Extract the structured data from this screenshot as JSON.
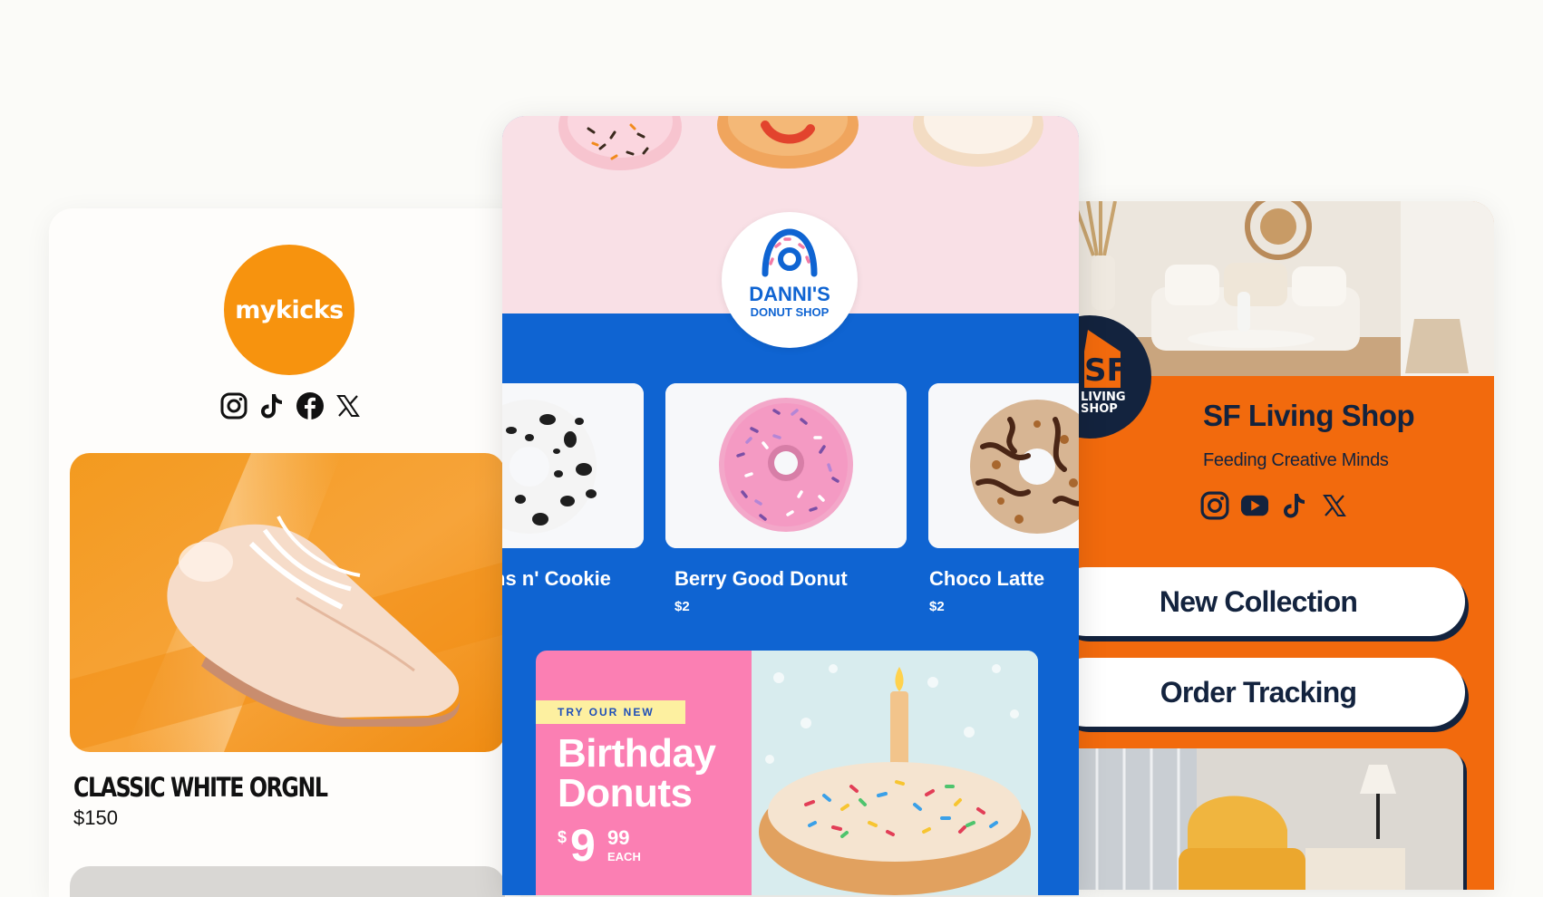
{
  "left_card": {
    "brand_logo_text": "mykicks",
    "social_icons": [
      "instagram-icon",
      "tiktok-icon",
      "facebook-icon",
      "x-icon"
    ],
    "product": {
      "name": "CLASSIC WHITE ORGNL",
      "price": "$150"
    },
    "colors": {
      "brand": "#f7930e"
    }
  },
  "middle_card": {
    "logo": {
      "line1": "DANNI'S",
      "line2": "DONUT SHOP"
    },
    "products": [
      {
        "name": "ns n' Cookie",
        "price": ""
      },
      {
        "name": "Berry Good Donut",
        "price": "$2"
      },
      {
        "name": "Choco Latte",
        "price": "$2"
      }
    ],
    "promo": {
      "tag": "TRY OUR NEW",
      "title_line1": "Birthday",
      "title_line2": "Donuts",
      "currency": "$",
      "price_main": "9",
      "price_cents": "99",
      "price_unit": "EACH"
    },
    "colors": {
      "brand": "#0f64d2",
      "hero_bg": "#f9e0e6",
      "promo_pink": "#fb7fb3"
    }
  },
  "right_card": {
    "badge": {
      "line1": "SF",
      "line2": "LIVING",
      "line3": "SHOP"
    },
    "title": "SF Living Shop",
    "tagline": "Feeding Creative Minds",
    "social_icons": [
      "instagram-icon",
      "youtube-icon",
      "tiktok-icon",
      "x-icon"
    ],
    "buttons": [
      {
        "label": "New Collection"
      },
      {
        "label": "Order Tracking"
      }
    ],
    "colors": {
      "brand": "#f26a0d",
      "ink": "#13233e"
    }
  }
}
